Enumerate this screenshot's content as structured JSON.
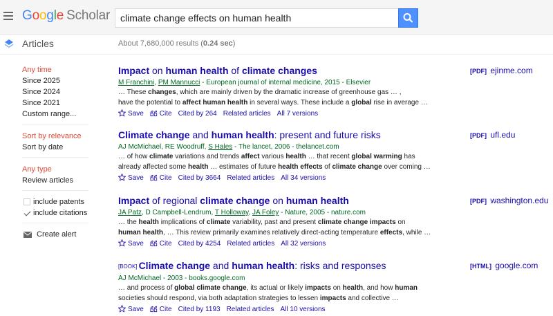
{
  "header": {
    "logo_letters": [
      "G",
      "o",
      "o",
      "g",
      "l",
      "e"
    ],
    "logo_suffix": "Scholar",
    "search_value": "climate change effects on human health"
  },
  "subbar": {
    "section": "Articles",
    "results_prefix": "About 7,680,000 results (",
    "results_time": "0.24 sec",
    "results_suffix": ")"
  },
  "sidebar": {
    "time_header": "Any time",
    "time_options": [
      "Since 2025",
      "Since 2024",
      "Since 2021",
      "Custom range..."
    ],
    "sort_selected": "Sort by relevance",
    "sort_other": "Sort by date",
    "type_header": "Any type",
    "type_option": "Review articles",
    "include_patents": "include patents",
    "include_citations": "include citations",
    "create_alert": "Create alert"
  },
  "results": [
    {
      "tag": "",
      "title_html": "<b>Impact</b> on <b>human health</b> of <b>climate changes</b>",
      "meta_html": "<span class=\"u\">M Franchini</span>, <span class=\"u\">PM Mannucci</span> - European journal of internal medicine, 2015 - Elsevier",
      "snippet1_html": "… These <b>changes</b>, which are mainly driven by the dramatic increase of greenhouse gas … ,",
      "snippet2_html": "have the potential to <b>affect human health</b> in several ways. These include a <b>global</b> rise in average …",
      "save": "Save",
      "cite": "Cite",
      "cited_by": "Cited by 264",
      "related": "Related articles",
      "versions": "All 7 versions",
      "source_tag": "[PDF]",
      "source": "ejinme.com"
    },
    {
      "tag": "",
      "title_html": "<b>Climate change</b> and <b>human health</b>: present and future risks",
      "meta_html": "AJ McMichael, RE Woodruff, <span class=\"u\">S Hales</span> - The lancet, 2006 - thelancet.com",
      "snippet1_html": "… of how <b>climate</b> variations and trends <b>affect</b> various <b>health</b> … that recent <b>global warming</b> has",
      "snippet2_html": "already affected some <b>health</b> … estimates of future <b>health effects</b> of <b>climate change</b> over coming …",
      "save": "Save",
      "cite": "Cite",
      "cited_by": "Cited by 3664",
      "related": "Related articles",
      "versions": "All 34 versions",
      "source_tag": "[PDF]",
      "source": "ufl.edu"
    },
    {
      "tag": "",
      "title_html": "<b>Impact</b> of regional <b>climate change</b> on <b>human health</b>",
      "meta_html": "<span class=\"u\">JA Patz</span>, D Campbell-Lendrum, <span class=\"u\">T Holloway</span>, <span class=\"u\">JA Foley</span> - Nature, 2005 - nature.com",
      "snippet1_html": "… the <b>health</b> implications of <b>climate</b> variability, past and present <b>climate change impacts</b> on",
      "snippet2_html": "<b>human health</b>, … This review primarily examines relatively direct-acting temperature <b>effects</b>, while …",
      "save": "Save",
      "cite": "Cite",
      "cited_by": "Cited by 4254",
      "related": "Related articles",
      "versions": "All 32 versions",
      "source_tag": "[PDF]",
      "source": "washington.edu"
    },
    {
      "tag": "[BOOK]",
      "title_html": "<b>Climate change</b> and <b>human health</b>: risks and responses",
      "meta_html": "AJ McMichael - 2003 - books.google.com",
      "snippet1_html": "… and process of <b>global climate change</b>, its actual or likely <b>impacts</b> on <b>health</b>, and how <b>human</b>",
      "snippet2_html": "societies should respond, via both adaptation strategies to lessen <b>impacts</b> and collective …",
      "save": "Save",
      "cite": "Cite",
      "cited_by": "Cited by 1193",
      "related": "Related articles",
      "versions": "All 10 versions",
      "source_tag": "[HTML]",
      "source": "google.com"
    }
  ]
}
